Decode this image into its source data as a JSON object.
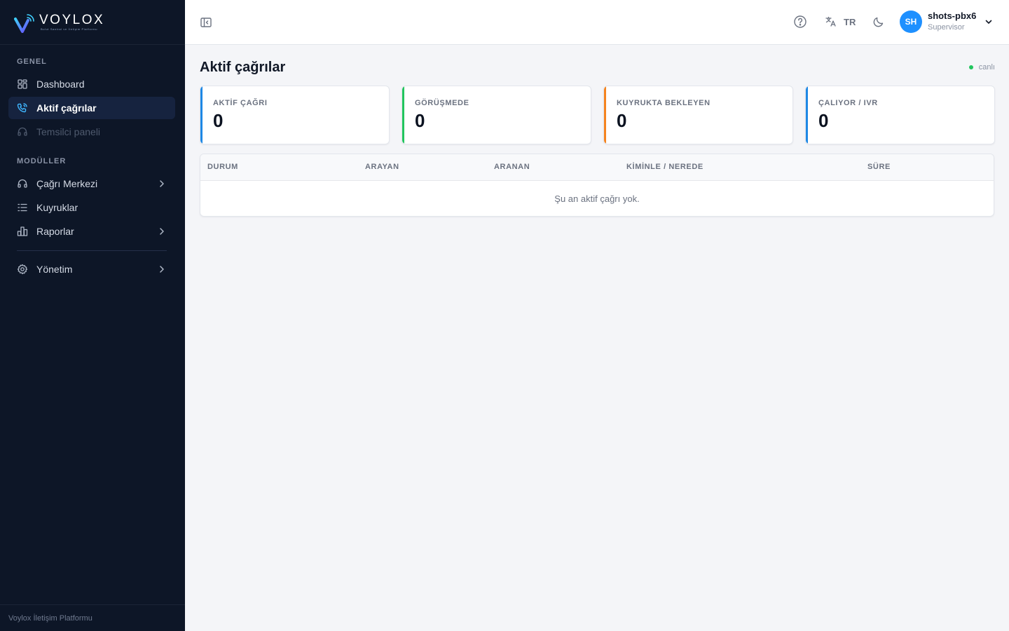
{
  "brand": {
    "name": "VOYLOX",
    "tagline": "Bulut Santral ve İletişim Platformu"
  },
  "sidebar": {
    "sections": [
      {
        "label": "GENEL"
      },
      {
        "label": "MODÜLLER"
      }
    ],
    "items": [
      {
        "label": "Dashboard",
        "icon": "grid-icon"
      },
      {
        "label": "Aktif çağrılar",
        "icon": "phone-icon"
      },
      {
        "label": "Temsilci paneli",
        "icon": "headset-icon"
      },
      {
        "label": "Çağrı Merkezi",
        "icon": "headset-icon"
      },
      {
        "label": "Kuyruklar",
        "icon": "list-icon"
      },
      {
        "label": "Raporlar",
        "icon": "bar-chart-icon"
      },
      {
        "label": "Yönetim",
        "icon": "gear-icon"
      }
    ],
    "footer": "Voylox İletişim Platformu",
    "active_color": "#16233f",
    "background": "#0d1627"
  },
  "topbar": {
    "language": "TR",
    "user": {
      "initials": "SH",
      "name": "shots-pbx6",
      "role": "Supervisor"
    },
    "avatar_color": "#1e90ff"
  },
  "main": {
    "title": "Aktif çağrılar",
    "live_label": "canlı",
    "cards": [
      {
        "label": "AKTİF ÇAĞRI",
        "value": "0",
        "color": "#1e88e5"
      },
      {
        "label": "GÖRÜŞMEDE",
        "value": "0",
        "color": "#22c55e"
      },
      {
        "label": "KUYRUKTA BEKLEYEN",
        "value": "0",
        "color": "#f5841f"
      },
      {
        "label": "ÇALIYOR / IVR",
        "value": "0",
        "color": "#1e88e5"
      }
    ],
    "table": {
      "columns": [
        "DURUM",
        "ARAYAN",
        "ARANAN",
        "KİMİNLE / NEREDE",
        "SÜRE"
      ],
      "empty_text": "Şu an aktif çağrı yok."
    }
  }
}
